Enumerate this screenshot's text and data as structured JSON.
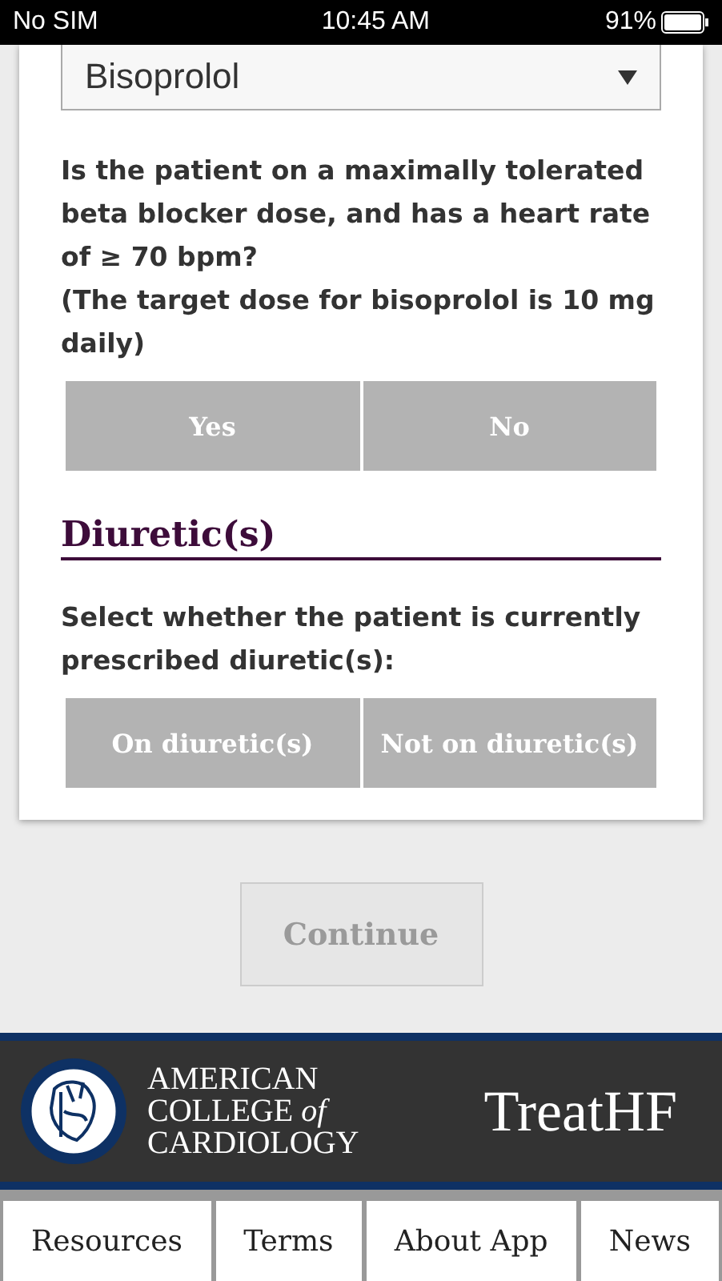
{
  "status_bar": {
    "carrier": "No SIM",
    "time": "10:45 AM",
    "battery": "91%"
  },
  "beta_blocker": {
    "select": {
      "value": "Bisoprolol"
    },
    "question": "Is the patient on a maximally tolerated beta blocker dose, and has a heart rate of ≥ 70 bpm?\n(The target dose for bisoprolol is 10 mg daily)",
    "options": [
      {
        "label": "Yes",
        "selected": false
      },
      {
        "label": "No",
        "selected": false
      }
    ]
  },
  "diuretics": {
    "heading": "Diuretic(s)",
    "question": "Select whether the patient is currently prescribed diuretic(s):",
    "options": [
      {
        "label": "On diuretic(s)",
        "selected": false
      },
      {
        "label": "Not on diuretic(s)",
        "selected": false
      }
    ]
  },
  "continue_button": {
    "label": "Continue",
    "disabled": true
  },
  "footer": {
    "logo_lines": [
      "AMERICAN",
      "COLLEGE *of*",
      "CARDIOLOGY"
    ],
    "app_name": "TreatHF"
  },
  "nav": [
    {
      "label": "Resources"
    },
    {
      "label": "Terms"
    },
    {
      "label": "About App"
    },
    {
      "label": "News"
    }
  ]
}
